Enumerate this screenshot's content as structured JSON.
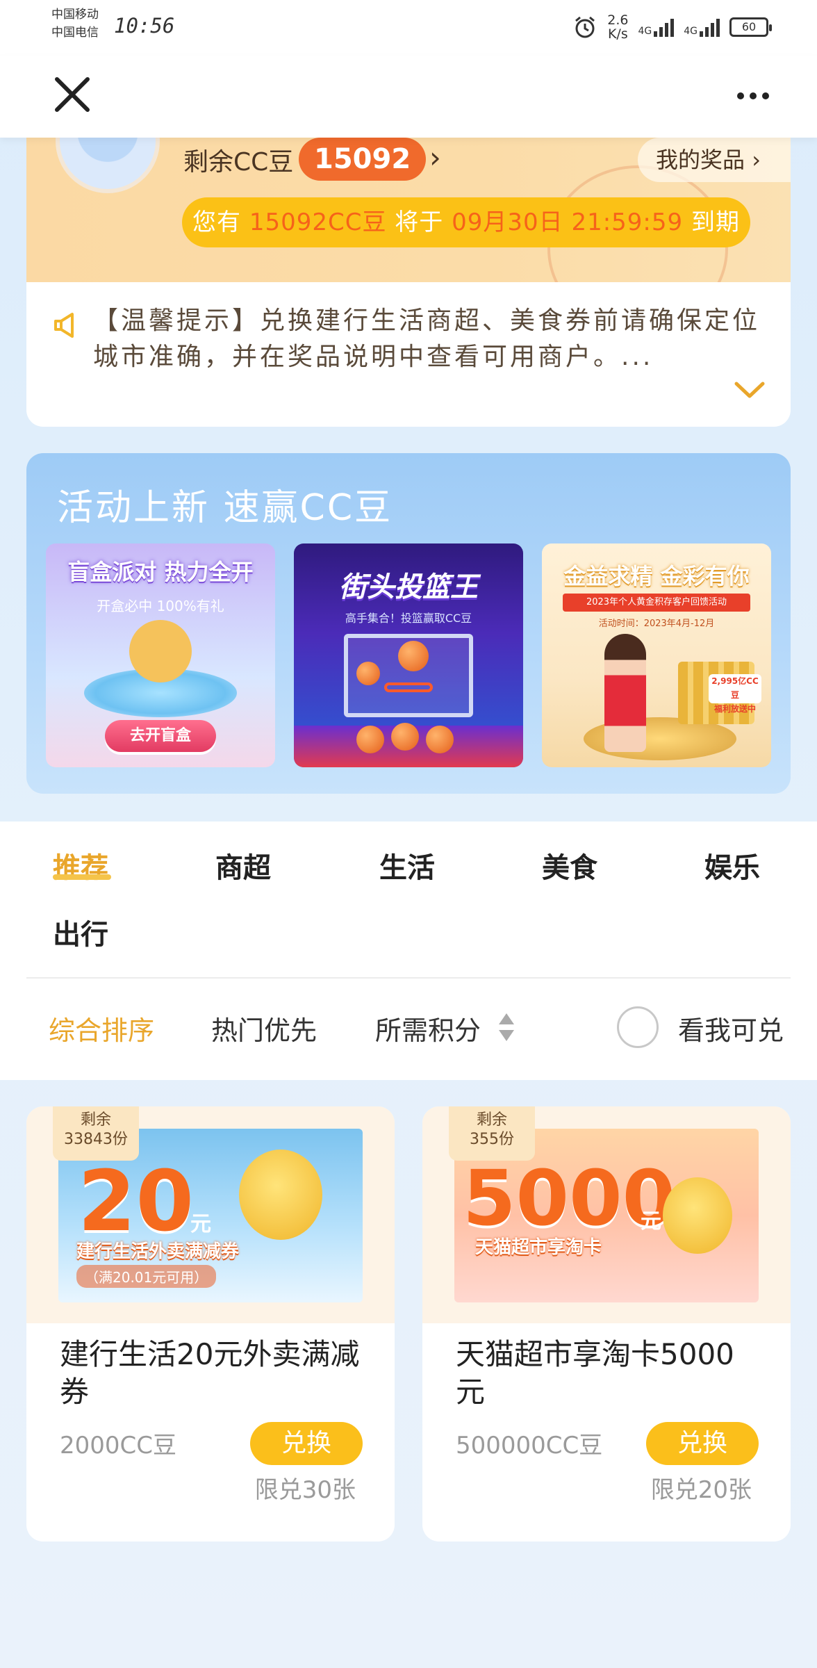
{
  "status_bar": {
    "carrier1": "中国移动",
    "carrier2": "中国电信",
    "time": "10:56",
    "net_speed_value": "2.6",
    "net_speed_unit": "K/s",
    "signal1": "4G",
    "signal2": "4G",
    "battery": "60"
  },
  "header_card": {
    "points_label": "剩余CC豆",
    "points_value": "15092",
    "my_prizes": "我的奖品",
    "expire_prefix": "您有",
    "expire_amount": "15092CC豆",
    "expire_mid": "将于",
    "expire_date": "09月30日 21:59:59",
    "expire_suffix": "到期"
  },
  "notice": {
    "text": "【温馨提示】兑换建行生活商超、美食券前请确保定位城市准确，并在奖品说明中查看可用商户。..."
  },
  "activity": {
    "title": "活动上新 速赢CC豆",
    "tiles": [
      {
        "title": "盲盒派对 热力全开",
        "subtitle": "开盒必中 100%有礼",
        "button": "去开盲盒"
      },
      {
        "title": "街头投篮王",
        "subtitle": "高手集合！投篮赢取CC豆"
      },
      {
        "title": "金益求精 金彩有你",
        "banner": "2023年个人黄金积存客户回馈活动",
        "date": "活动时间：2023年4月-12月",
        "badge_line1": "2,995亿CC豆",
        "badge_line2": "福利放送中"
      }
    ]
  },
  "categories": {
    "tabs": [
      "推荐",
      "商超",
      "生活",
      "美食",
      "娱乐",
      "出行"
    ],
    "active_index": 0
  },
  "sort": {
    "options": [
      "综合排序",
      "热门优先",
      "所需积分"
    ],
    "active_index": 0,
    "filter_label": "看我可兑"
  },
  "products": [
    {
      "stock_label": "剩余",
      "stock_count": "33843份",
      "img_number": "20",
      "img_unit": "元",
      "img_caption": "建行生活外卖满减券",
      "img_sub": "（满20.01元可用）",
      "name": "建行生活20元外卖满减券",
      "price": "2000CC豆",
      "button": "兑换",
      "limit": "限兑30张"
    },
    {
      "stock_label": "剩余",
      "stock_count": "355份",
      "img_number": "5000",
      "img_unit": "元",
      "img_caption": "天猫超市享淘卡",
      "name": "天猫超市享淘卡5000元",
      "price": "500000CC豆",
      "button": "兑换",
      "limit": "限兑20张"
    }
  ],
  "colors": {
    "accent": "#e9a62b",
    "badge_orange": "#f06a2c",
    "button_yellow": "#fbbf1b"
  }
}
